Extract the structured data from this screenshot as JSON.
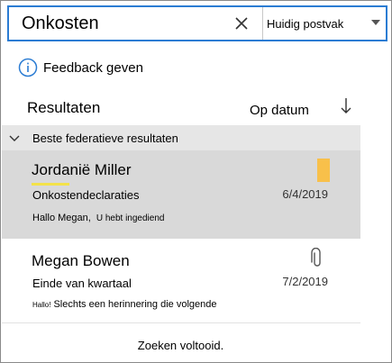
{
  "search": {
    "query": "Onkosten",
    "scope": "Huidig postvak"
  },
  "feedback": {
    "label": "Feedback geven"
  },
  "results": {
    "title": "Resultaten",
    "sort_label": "Op datum",
    "group_label": "Beste federatieve resultaten",
    "items": [
      {
        "sender": "Jordanië Miller",
        "subject": "Onkostendeclaraties",
        "date": "6/4/2019",
        "preview_part1": "Hallo Megan,",
        "preview_part2": "U hebt ingediend",
        "flagged": true,
        "has_attachment": false
      },
      {
        "sender": "Megan Bowen",
        "subject": "Einde van kwartaal",
        "date": "7/2/2019",
        "preview_part1": "Hallo!",
        "preview_part2": "Slechts een herinnering die volgende",
        "flagged": false,
        "has_attachment": true
      }
    ]
  },
  "status": "Zoeken voltooid.",
  "colors": {
    "accent": "#2b7cd3",
    "selected_item": "#d9d9d9",
    "group_header": "#e6e6e6",
    "flag": "#f8c04a",
    "highlight": "#f3e24a"
  }
}
